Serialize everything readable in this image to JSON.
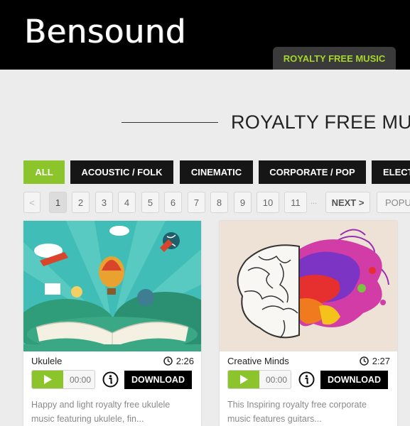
{
  "header": {
    "logo": "Bensound",
    "nav_tab": "ROYALTY FREE MUSIC"
  },
  "page": {
    "title": "ROYALTY FREE MU"
  },
  "categories": [
    "ALL",
    "ACOUSTIC / FOLK",
    "CINEMATIC",
    "CORPORATE / POP",
    "ELECT"
  ],
  "pagination": {
    "prev": "<",
    "pages": [
      "1",
      "2",
      "3",
      "4",
      "5",
      "6",
      "7",
      "8",
      "9",
      "10",
      "11"
    ],
    "ellipsis": "...",
    "next": "NEXT >",
    "sort": "POPU"
  },
  "colors": {
    "accent": "#8bc52b",
    "header_bg": "#000000",
    "nav_text": "#a6d52d"
  },
  "tracks": [
    {
      "name": "Ukulele",
      "duration": "2:26",
      "time": "00:00",
      "download": "DOWNLOAD",
      "description": "Happy and light royalty free ukulele music featuring ukulele, fin..."
    },
    {
      "name": "Creative Minds",
      "duration": "2:27",
      "time": "00:00",
      "download": "DOWNLOAD",
      "description": "This Inspiring royalty free corporate music features guitars..."
    }
  ]
}
